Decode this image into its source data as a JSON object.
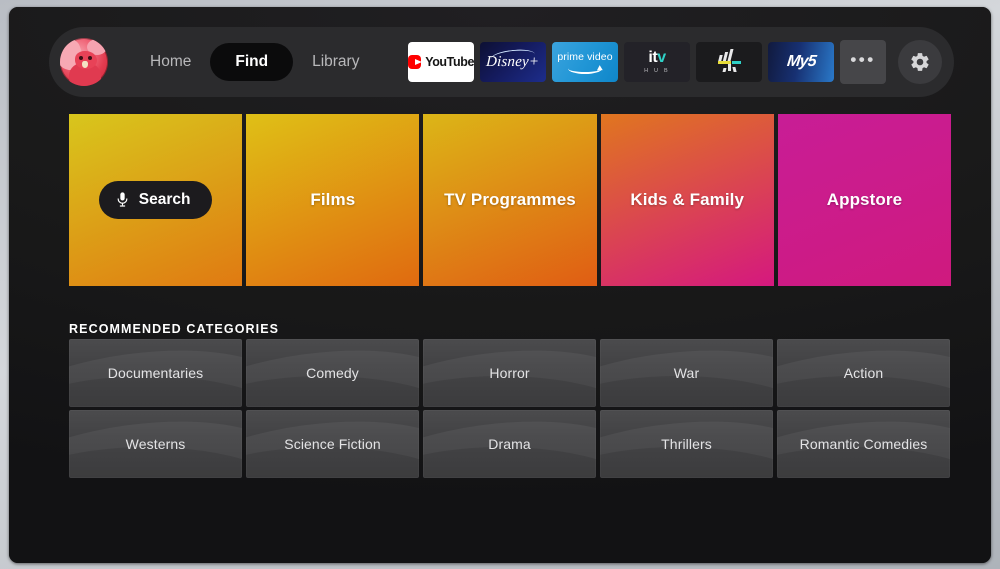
{
  "nav": {
    "avatar_name": "profile-avatar",
    "links": [
      {
        "label": "Home",
        "active": false
      },
      {
        "label": "Find",
        "active": true
      },
      {
        "label": "Library",
        "active": false
      }
    ],
    "apps": [
      {
        "name": "youtube",
        "label": "YouTube"
      },
      {
        "name": "disney-plus",
        "label": "Disney+"
      },
      {
        "name": "prime-video",
        "label": "prime video"
      },
      {
        "name": "itv-hub",
        "label": "itv",
        "sub": "H U B"
      },
      {
        "name": "channel-4",
        "label": "4"
      },
      {
        "name": "my5",
        "label": "My5"
      }
    ],
    "more_label": "•••",
    "settings_label": "Settings"
  },
  "tiles": [
    {
      "label": "Search",
      "is_search": true,
      "mic": "microphone-icon",
      "start": "#d8c61c",
      "end": "#e07a12"
    },
    {
      "label": "Films",
      "is_search": false,
      "start": "#dfc016",
      "end": "#e06a10"
    },
    {
      "label": "TV Programmes",
      "is_search": false,
      "start": "#dcb617",
      "end": "#e05d14"
    },
    {
      "label": "Kids & Family",
      "is_search": false,
      "start": "#e0761f",
      "end": "#d5187f"
    },
    {
      "label": "Appstore",
      "is_search": false,
      "start": "#c81d96",
      "end": "#cf1a7e"
    }
  ],
  "recommended": {
    "header": "RECOMMENDED CATEGORIES",
    "categories": [
      "Documentaries",
      "Comedy",
      "Horror",
      "War",
      "Action",
      "Westerns",
      "Science Fiction",
      "Drama",
      "Thrillers",
      "Romantic Comedies"
    ]
  },
  "colors": {
    "frame": "#1a1a1c",
    "navbar": "#2b2b2d",
    "active_pill": "#0b0b0c",
    "category_tile": "#434345",
    "text_primary": "#ffffff",
    "text_muted": "#b8b8ba"
  }
}
